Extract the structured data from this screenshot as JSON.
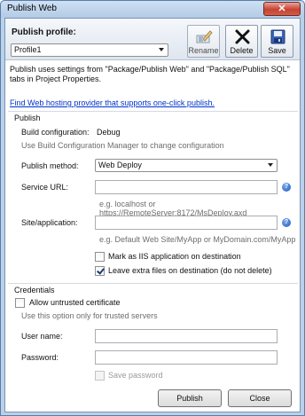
{
  "window": {
    "title": "Publish Web",
    "close_glyph": "✕"
  },
  "profile": {
    "label": "Publish profile:",
    "selected": "Profile1"
  },
  "toolbar": {
    "rename_label": "Rename",
    "delete_label": "Delete",
    "save_label": "Save"
  },
  "intro": {
    "text": "Publish uses settings from \"Package/Publish Web\" and \"Package/Publish SQL\" tabs in Project Properties.",
    "link": "Find Web hosting provider that supports one-click publish."
  },
  "publish": {
    "group_title": "Publish",
    "build_config_label": "Build configuration:",
    "build_config_value": "Debug",
    "build_config_hint": "Use Build Configuration Manager to change configuration",
    "method_label": "Publish method:",
    "method_value": "Web Deploy",
    "service_url_label": "Service URL:",
    "service_url_value": "",
    "service_url_hint": "e.g. localhost or https://RemoteServer:8172/MsDeploy.axd",
    "site_label": "Site/application:",
    "site_value": "",
    "site_hint": "e.g. Default Web Site/MyApp or MyDomain.com/MyApp",
    "mark_iis_label": "Mark as IIS application on destination",
    "mark_iis_checked": false,
    "leave_extra_label": "Leave extra files on destination (do not delete)",
    "leave_extra_checked": true,
    "help_glyph": "?"
  },
  "credentials": {
    "group_title": "Credentials",
    "allow_untrusted_label": "Allow untrusted certificate",
    "allow_untrusted_checked": false,
    "trusted_hint": "Use this option only for trusted servers",
    "username_label": "User name:",
    "username_value": "",
    "password_label": "Password:",
    "password_value": "",
    "save_password_label": "Save password",
    "save_password_checked": false
  },
  "footer": {
    "publish_label": "Publish",
    "close_label": "Close"
  }
}
